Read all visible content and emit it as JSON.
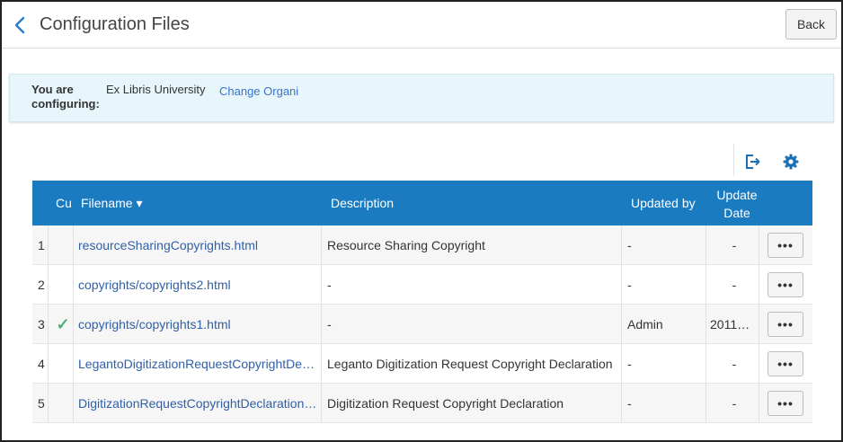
{
  "header": {
    "title": "Configuration Files",
    "back_label": "Back"
  },
  "config_bar": {
    "label": "You are configuring:",
    "organization": "Ex Libris University",
    "change_link": "Change Organi"
  },
  "toolbar": {
    "export_icon": "export-icon",
    "settings_icon": "gear-icon"
  },
  "table": {
    "columns": {
      "customized": "Cu",
      "filename": "Filename ▾",
      "description": "Description",
      "updated_by": "Updated by",
      "update_date_line1": "Update",
      "update_date_line2": "Date"
    },
    "rows": [
      {
        "num": "1",
        "customized": "",
        "filename": "resourceSharingCopyrights.html",
        "description": "Resource Sharing Copyright",
        "updated_by": "-",
        "update_date": "-",
        "more": "•••"
      },
      {
        "num": "2",
        "customized": "",
        "filename": "copyrights/copyrights2.html",
        "description": "-",
        "updated_by": "-",
        "update_date": "-",
        "more": "•••"
      },
      {
        "num": "3",
        "customized": "✓",
        "filename": "copyrights/copyrights1.html",
        "description": "-",
        "updated_by": "Admin",
        "update_date": "2011…",
        "more": "•••"
      },
      {
        "num": "4",
        "customized": "",
        "filename": "LegantoDigitizationRequestCopyrightDe…",
        "description": "Leganto Digitization Request Copyright Declaration",
        "updated_by": "-",
        "update_date": "-",
        "more": "•••"
      },
      {
        "num": "5",
        "customized": "",
        "filename": "DigitizationRequestCopyrightDeclaration…",
        "description": "Digitization Request Copyright Declaration",
        "updated_by": "-",
        "update_date": "-",
        "more": "•••"
      }
    ]
  },
  "colors": {
    "header_bg": "#1b7bc0",
    "link": "#2f5fa7",
    "check": "#4caf7a",
    "info_bg": "#e7f6fb"
  }
}
